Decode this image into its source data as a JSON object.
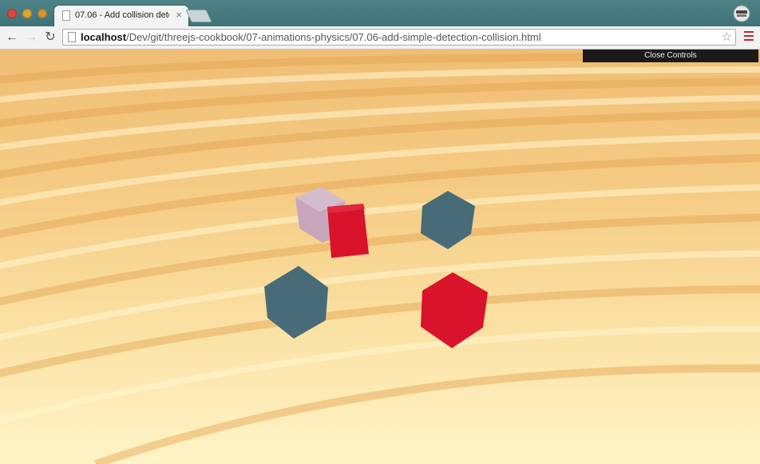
{
  "browser": {
    "tab_title": "07.06 - Add collision dete",
    "url_host": "localhost",
    "url_path": "/Dev/git/threejs-cookbook/07-animations-physics/07.06-add-simple-detection-collision.html"
  },
  "scene": {
    "close_controls_label": "Close Controls",
    "cubes": [
      {
        "name": "lavender-cube",
        "color": "#c8a8c0"
      },
      {
        "name": "red-cube-upper",
        "color": "#d9132a"
      },
      {
        "name": "teal-cube-upper",
        "color": "#496f7a"
      },
      {
        "name": "teal-cube-lower",
        "color": "#496f7a"
      },
      {
        "name": "red-cube-lower",
        "color": "#d9132a"
      }
    ]
  }
}
